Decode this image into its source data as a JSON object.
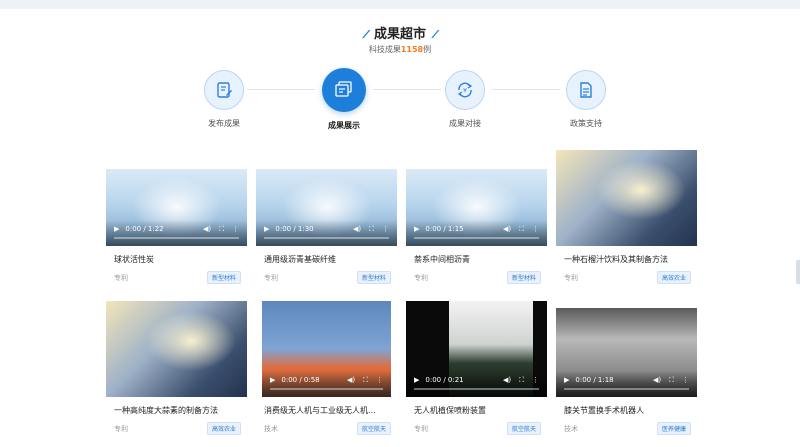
{
  "header": {
    "title": "成果超市",
    "subtitle_prefix": "科技成果",
    "subtitle_count": "1158",
    "subtitle_suffix": "例",
    "deco": "⁄⁄"
  },
  "steps": [
    {
      "label": "发布成果",
      "icon": "edit-icon",
      "active": false
    },
    {
      "label": "成果展示",
      "icon": "display-icon",
      "active": true
    },
    {
      "label": "成果对接",
      "icon": "exchange-icon",
      "active": false
    },
    {
      "label": "政策支持",
      "icon": "document-icon",
      "active": false
    }
  ],
  "cards": [
    {
      "title": "球状活性炭",
      "kind": "专利",
      "tag": "新型材料",
      "time": "0:00 / 1:22"
    },
    {
      "title": "通用级沥青基碳纤维",
      "kind": "专利",
      "tag": "新型材料",
      "time": "0:00 / 1:30"
    },
    {
      "title": "萘系中间相沥青",
      "kind": "专利",
      "tag": "新型材料",
      "time": "0:00 / 1:15"
    },
    {
      "title": "一种石榴汁饮料及其制备方法",
      "kind": "专利",
      "tag": "高效农业",
      "time": ""
    },
    {
      "title": "一种高纯度大蒜素的制备方法",
      "kind": "专利",
      "tag": "高效农业",
      "time": ""
    },
    {
      "title": "消费级无人机与工业级无人机...",
      "kind": "技术",
      "tag": "航空航天",
      "time": "0:00 / 0:58"
    },
    {
      "title": "无人机植保喷粉装置",
      "kind": "专利",
      "tag": "航空航天",
      "time": "0:00 / 0:21"
    },
    {
      "title": "膝关节置换手术机器人",
      "kind": "技术",
      "tag": "医养健康",
      "time": "0:00 / 1:18"
    }
  ],
  "colors": {
    "accent": "#1e7fdb",
    "highlight": "#ff7a1a",
    "tag_text": "#2f7ad0"
  }
}
